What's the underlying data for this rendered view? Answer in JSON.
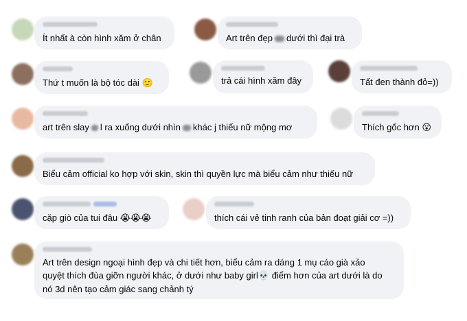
{
  "comments": [
    {
      "text": "Ít nhất à còn hình xăm ở chân"
    },
    {
      "text_before": "Art trên đẹp",
      "text_after": "dưới thì đại trà"
    },
    {
      "text": "Thứ t muốn là bộ tóc dài",
      "emoji": "🙂"
    },
    {
      "text": "trả cái hình xăm đây"
    },
    {
      "text": "Tất đen thành đỏ=))"
    },
    {
      "text_a": "art trên slay",
      "text_b": "l ra xuống dưới nhìn",
      "text_c": "khác j thiếu nữ mộng mơ"
    },
    {
      "text": "Thích gốc hơn",
      "emoji": "😮"
    },
    {
      "text": "Biểu cảm official ko hợp với skin, skin thì quyền lực mà biểu cảm như thiếu nữ"
    },
    {
      "text": "cặp giò của tui đâu",
      "emoji": "😭😭😭"
    },
    {
      "text": "thích cái vẻ tinh ranh của bản đoạt giải cơ =))"
    },
    {
      "line1": "Art trên design ngoại hình đẹp và chi tiết hơn, biểu cảm ra dáng 1 mụ cáo già xảo",
      "line2_before": "quyệt thích đùa giỡn người khác, ở dưới như baby girl",
      "emoji": "💀",
      "line2_after": "điểm hơn của art dưới là do",
      "line3": "nó 3d nên tạo cảm giác sang chảnh tý"
    }
  ],
  "colors": {
    "bubble": "#f0f2f5",
    "text": "#050505",
    "placeholder_name": "#c9ccd1"
  }
}
